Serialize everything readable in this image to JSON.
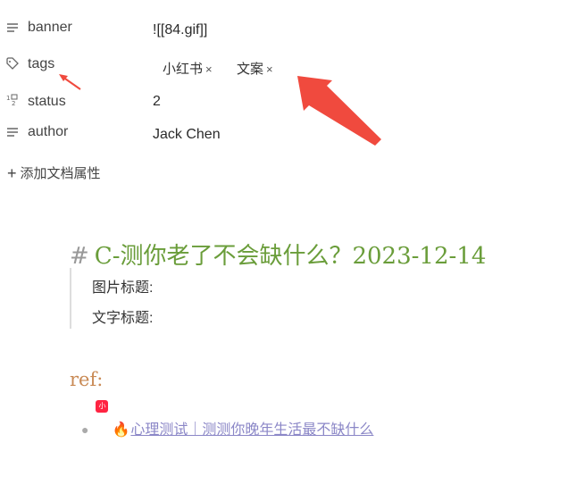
{
  "properties": [
    {
      "key": "banner",
      "value": "![[84.gif]]",
      "icon": "text-lines-icon"
    },
    {
      "key": "tags",
      "icon": "tag-icon",
      "tags": [
        {
          "label": "小红书",
          "remove": "×"
        },
        {
          "label": "文案",
          "remove": "×"
        }
      ]
    },
    {
      "key": "status",
      "value": "2",
      "icon": "number-icon"
    },
    {
      "key": "author",
      "value": "Jack Chen",
      "icon": "text-lines-icon"
    }
  ],
  "add_property": {
    "label": "添加文档属性",
    "icon": "plus-icon"
  },
  "content": {
    "heading": {
      "hash": "#",
      "text": "C-测你老了不会缺什么？2023-12-14"
    },
    "quote_lines": [
      "图片标题:",
      "文字标题:"
    ],
    "ref_label": "ref:",
    "list": [
      {
        "badge": "小红书",
        "emoji": "🔥",
        "link_text": "心理测试｜测测你晚年生活最不缺什么"
      }
    ]
  },
  "colors": {
    "heading": "#6a9d3a",
    "ref": "#c98a55",
    "link": "#8b87c7",
    "arrow": "#f04a3e"
  }
}
